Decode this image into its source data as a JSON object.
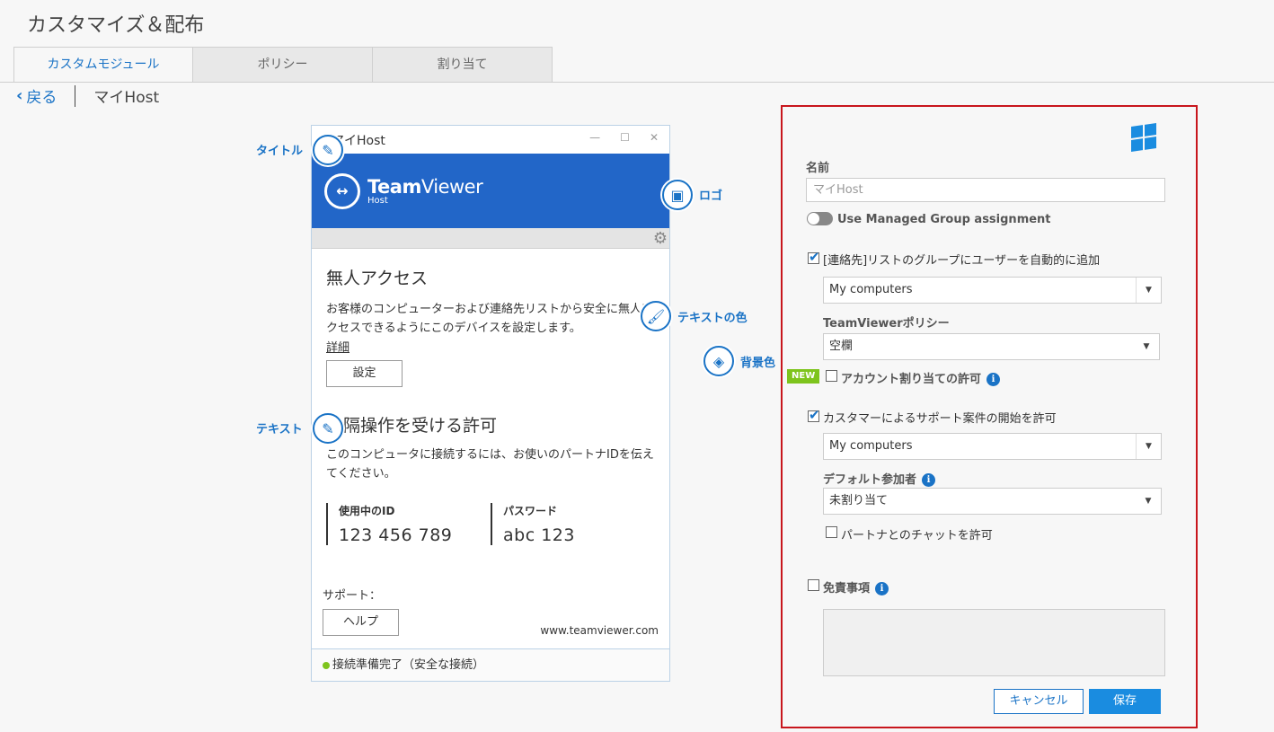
{
  "header": {
    "title": "カスタマイズ＆配布"
  },
  "tabs": [
    {
      "label": "カスタムモジュール",
      "active": true
    },
    {
      "label": "ポリシー",
      "active": false
    },
    {
      "label": "割り当て",
      "active": false
    }
  ],
  "breadcrumb": {
    "back": "戻る",
    "current": "マイHost"
  },
  "preview": {
    "window_title": "マイHost",
    "brand_name_bold": "Team",
    "brand_name_light": "Viewer",
    "brand_sub": "Host",
    "section1_heading": "無人アクセス",
    "section1_text": "お客様のコンピューターおよび連絡先リストから安全に無人アクセスできるようにこのデバイスを設定します。",
    "section1_link": "詳細",
    "section1_button": "設定",
    "section2_heading": "遠隔操作を受ける許可",
    "section2_text": "このコンピュータに接続するには、お使いのパートナIDを伝えてください。",
    "id_label": "使用中のID",
    "id_value": "123 456 789",
    "password_label": "パスワード",
    "password_value": "abc 123",
    "support_label": "サポート：",
    "help_button": "ヘルプ",
    "website": "www.teamviewer.com",
    "status": "接続準備完了（安全な接続）"
  },
  "annotations": {
    "title": "タイトル",
    "logo": "ロゴ",
    "text_color": "テキストの色",
    "background_color": "背景色",
    "text": "テキスト"
  },
  "settings": {
    "name_label": "名前",
    "name_value": "マイHost",
    "managed_group_label": "Use Managed Group assignment",
    "auto_add_label": "[連絡先]リストのグループにユーザーを自動的に追加",
    "auto_add_group": "My computers",
    "policy_label": "TeamViewerポリシー",
    "policy_value": "空欄",
    "new_badge": "NEW",
    "account_assign_label": "アカウント割り当ての許可",
    "support_case_label": "カスタマーによるサポート案件の開始を許可",
    "support_case_group": "My computers",
    "default_participant_label": "デフォルト参加者",
    "default_participant_value": "未割り当て",
    "partner_chat_label": "パートナとのチャットを許可",
    "disclaimer_label": "免責事項",
    "cancel_button": "キャンセル",
    "save_button": "保存"
  },
  "colors": {
    "accent": "#1a73c6",
    "banner": "#2266c8",
    "panel_border": "#c8161d",
    "new_badge": "#7ec41d",
    "save_button": "#1a8ce0"
  },
  "icons": {
    "pencil": "pencil-icon",
    "logo": "image-icon",
    "brush": "brush-icon",
    "paint_bucket": "paint-bucket-icon",
    "gear": "gear-icon",
    "info": "info-icon",
    "windows": "windows-icon",
    "apple": "apple-icon"
  }
}
